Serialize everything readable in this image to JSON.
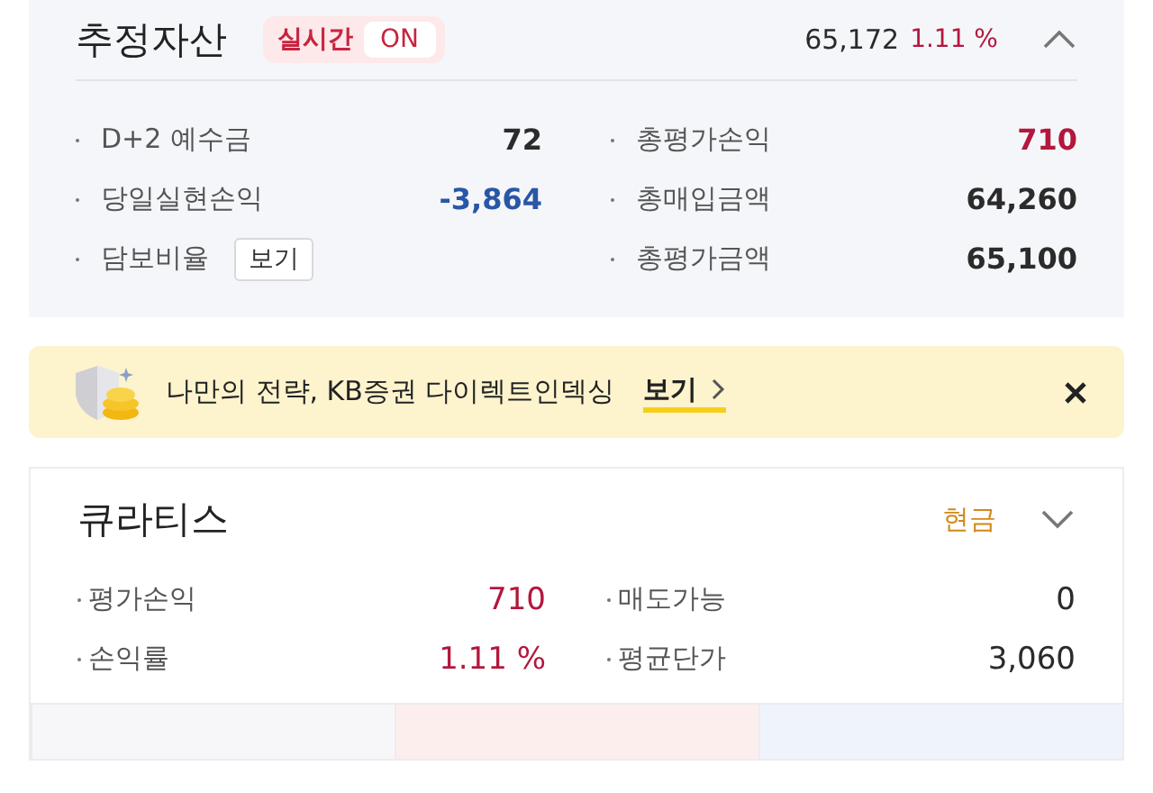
{
  "summary": {
    "title": "추정자산",
    "realtime": {
      "label": "실시간",
      "state": "ON",
      "on": true
    },
    "total": "65,172",
    "rate": {
      "text": "1.11 %",
      "color": "#b3173d"
    },
    "expanded": true,
    "left": [
      {
        "label": "D+2 예수금",
        "value": "72",
        "color": "#2b2b2b",
        "kind": "value"
      },
      {
        "label": "당일실현손익",
        "value": "-3,864",
        "color": "#2a56a6",
        "kind": "value"
      },
      {
        "label": "담보비율",
        "button": "보기",
        "kind": "button"
      }
    ],
    "right": [
      {
        "label": "총평가손익",
        "value": "710",
        "color": "#b3173d",
        "kind": "value"
      },
      {
        "label": "총매입금액",
        "value": "64,260",
        "color": "#2b2b2b",
        "kind": "value"
      },
      {
        "label": "총평가금액",
        "value": "65,100",
        "color": "#2b2b2b",
        "kind": "value"
      }
    ]
  },
  "banner": {
    "text": "나만의 전략, KB증권 다이렉트인덱싱",
    "link": "보기"
  },
  "holding": {
    "name": "큐라티스",
    "account_type": "현금",
    "expanded": false,
    "left": [
      {
        "label": "평가손익",
        "value": "710",
        "color": "#b3173d"
      },
      {
        "label": "손익률",
        "value": "1.11 %",
        "color": "#b3173d"
      }
    ],
    "right": [
      {
        "label": "매도가능",
        "value": "0",
        "color": "#2b2b2b"
      },
      {
        "label": "평균단가",
        "value": "3,060",
        "color": "#2b2b2b"
      }
    ]
  },
  "order_buttons": [
    {
      "kind": "neutral"
    },
    {
      "kind": "buy"
    },
    {
      "kind": "sell"
    }
  ]
}
